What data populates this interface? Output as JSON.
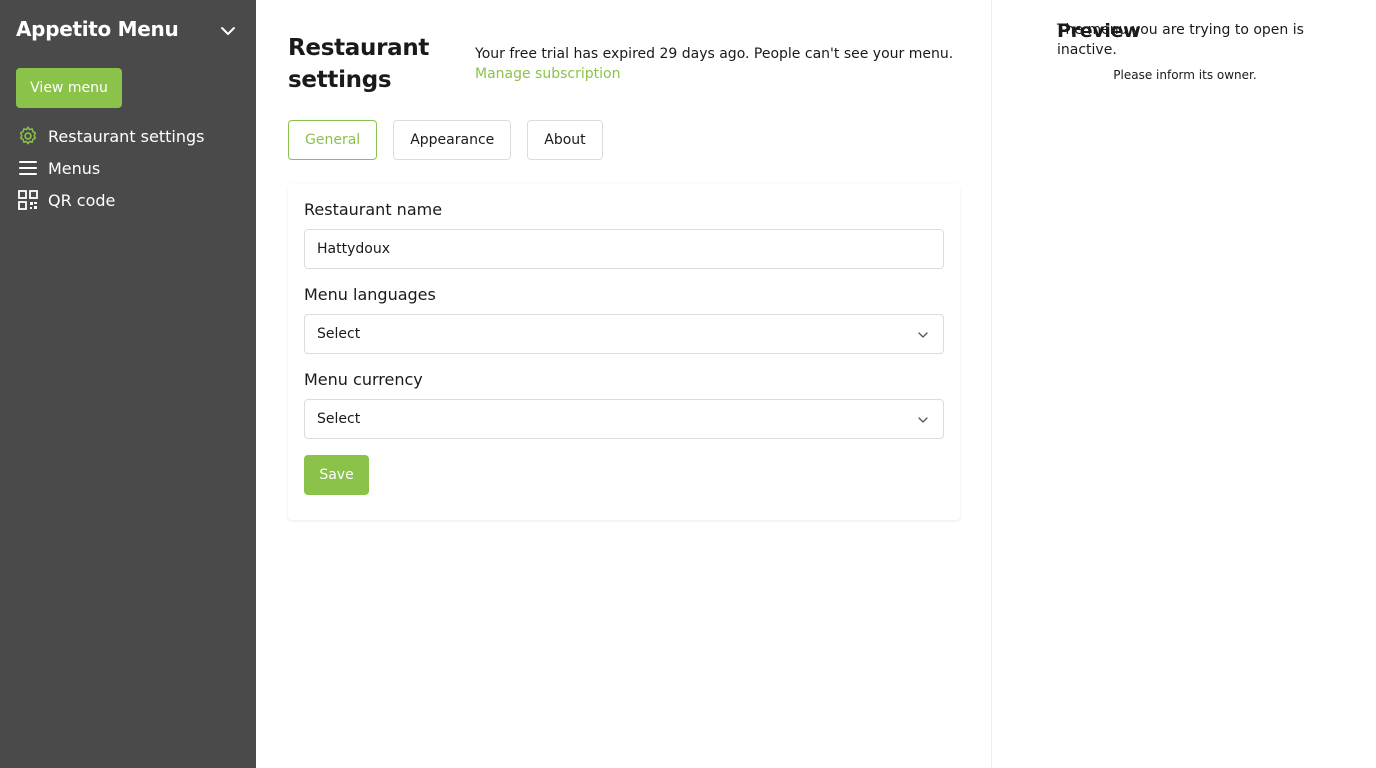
{
  "sidebar": {
    "brand": "Appetito Menu",
    "view_menu_label": "View menu",
    "items": [
      {
        "label": "Restaurant settings",
        "icon": "gear-icon"
      },
      {
        "label": "Menus",
        "icon": "hamburger-icon"
      },
      {
        "label": "QR code",
        "icon": "qr-code-icon"
      }
    ]
  },
  "main": {
    "title": "Restaurant settings",
    "trial_message": "Your free trial has expired 29 days ago. People can't see your menu.",
    "manage_link": "Manage subscription",
    "tabs": [
      {
        "label": "General",
        "active": true
      },
      {
        "label": "Appearance",
        "active": false
      },
      {
        "label": "About",
        "active": false
      }
    ],
    "form": {
      "name_label": "Restaurant name",
      "name_value": "Hattydoux",
      "languages_label": "Menu languages",
      "languages_value": "Select",
      "currency_label": "Menu currency",
      "currency_value": "Select",
      "save_label": "Save"
    }
  },
  "preview": {
    "title": "Preview",
    "message": "The menu you are trying to open is inactive.",
    "sub": "Please inform its owner."
  },
  "colors": {
    "accent": "#8bc34a",
    "sidebar_bg": "#4a4a4a"
  }
}
